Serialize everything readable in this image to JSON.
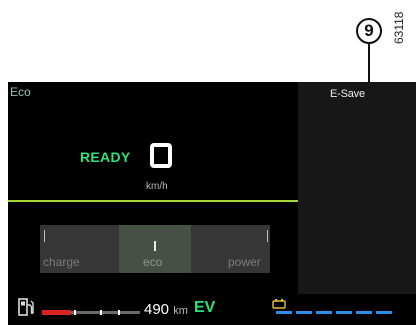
{
  "figure": {
    "code": "63118",
    "callout_number": "9"
  },
  "dashboard": {
    "mode_title": "Eco",
    "esave_label": "E-Save",
    "status": "READY",
    "speed_unit": "km/h",
    "gauge_labels": {
      "charge": "charge",
      "eco": "eco",
      "power": "power"
    },
    "range_value": "490",
    "range_unit": "km",
    "drive_mode": "EV",
    "fuel_level": 0.3,
    "battery_level": 1.0,
    "colors": {
      "ready_green": "#2ee27a",
      "accent_line": "#a4d733",
      "fuel_red": "#d92323",
      "battery_blue": "#2b8ee8"
    },
    "icons": [
      "fuel-pump-icon",
      "battery-plug-icon"
    ]
  }
}
